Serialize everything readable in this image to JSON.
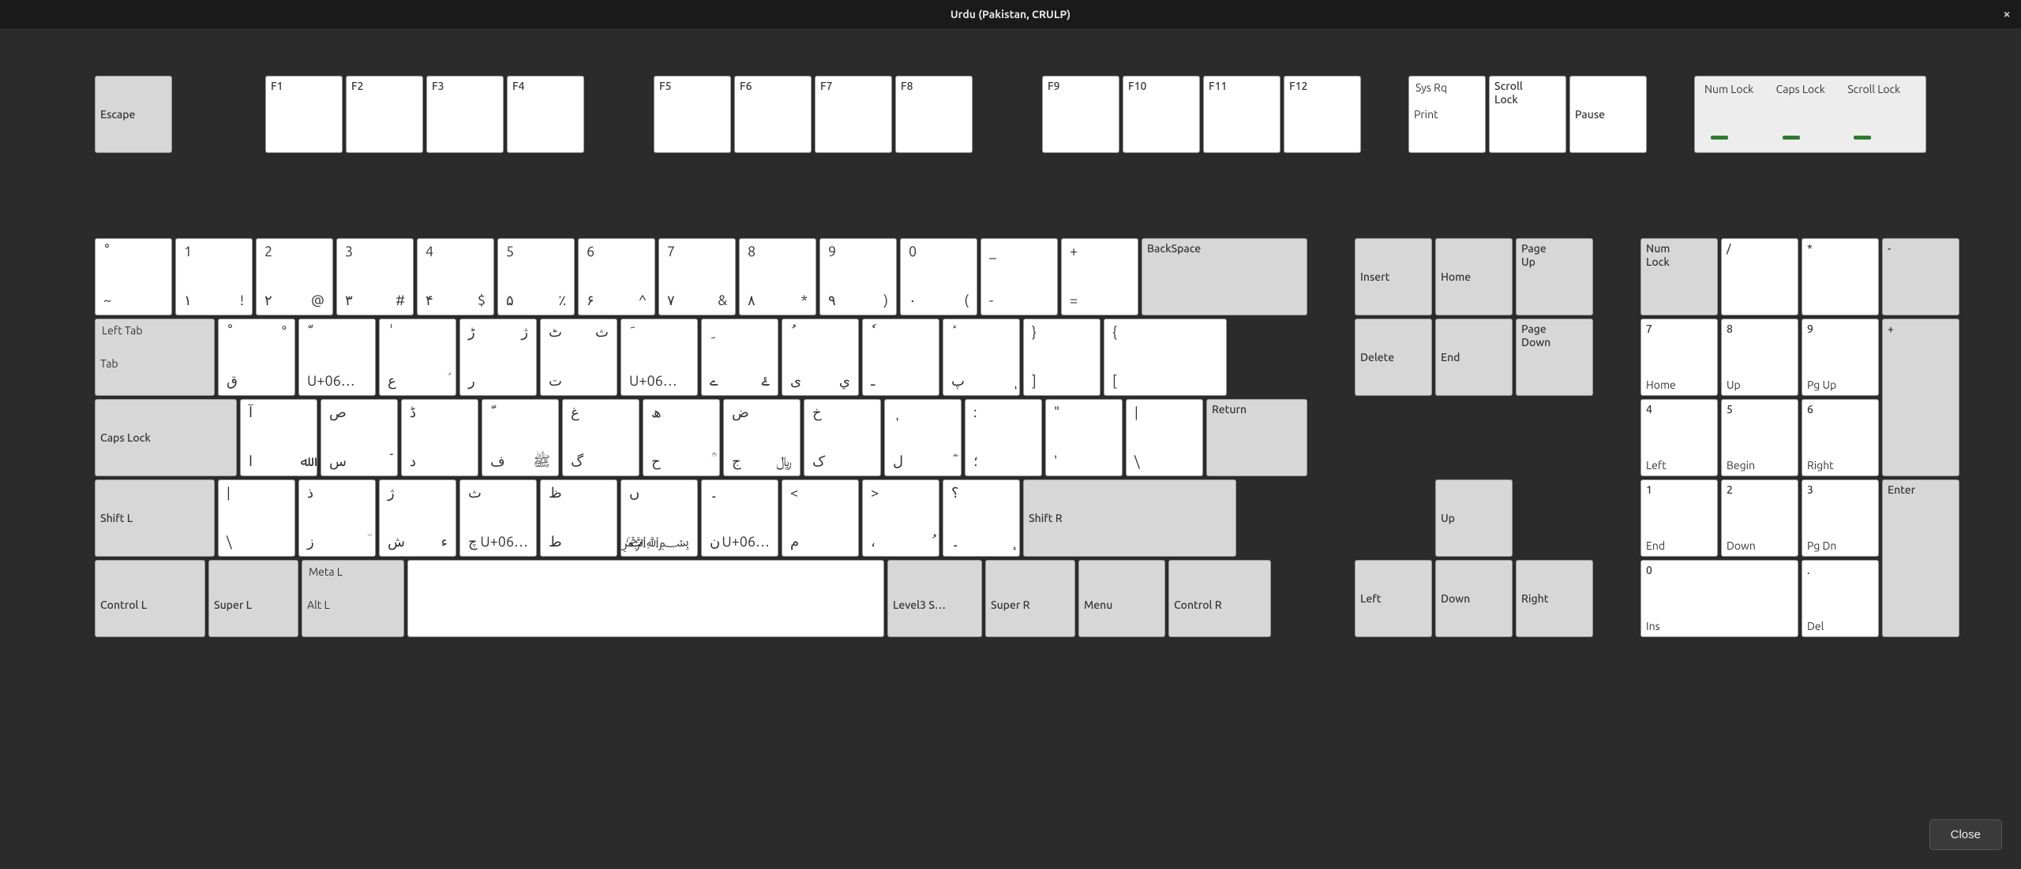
{
  "window": {
    "title": "Urdu (Pakistan, CRULP)"
  },
  "footer": {
    "close": "Close"
  },
  "fnrow": {
    "escape": "Escape",
    "f": [
      "F1",
      "F2",
      "F3",
      "F4",
      "F5",
      "F6",
      "F7",
      "F8",
      "F9",
      "F10",
      "F11",
      "F12"
    ],
    "sysrq_top": "Sys Rq",
    "sysrq_bot": "Print",
    "scrolllock": "Scroll Lock",
    "pause": "Pause",
    "locks": {
      "num": "Num Lock",
      "caps": "Caps Lock",
      "scroll": "Scroll Lock"
    }
  },
  "row1": [
    {
      "tl": "ْ",
      "bl": "~"
    },
    {
      "tl": "1",
      "bl": "١",
      "br": "!"
    },
    {
      "tl": "2",
      "bl": "٢",
      "br": "@"
    },
    {
      "tl": "3",
      "bl": "٣",
      "br": "#"
    },
    {
      "tl": "4",
      "bl": "۴",
      "br": "$"
    },
    {
      "tl": "5",
      "bl": "۵",
      "br": "٪"
    },
    {
      "tl": "6",
      "bl": "۶",
      "br": "^"
    },
    {
      "tl": "7",
      "bl": "۷",
      "br": "&"
    },
    {
      "tl": "8",
      "bl": "۸",
      "br": "*"
    },
    {
      "tl": "9",
      "bl": "۹",
      "br": ")"
    },
    {
      "tl": "0",
      "bl": "٠",
      "br": "("
    },
    {
      "tl": "_",
      "bl": "-"
    },
    {
      "tl": "+",
      "bl": "="
    }
  ],
  "backspace": "BackSpace",
  "tab": {
    "top": "Left Tab",
    "bot": "Tab"
  },
  "row2": [
    {
      "tl": "ْ",
      "bl": "ق",
      "tr": "°"
    },
    {
      "tl": "ّ",
      "bl": "U+06…",
      "tr": ""
    },
    {
      "tl": "ٰ",
      "bl": "ع",
      "tr": "",
      "br": "ؑ"
    },
    {
      "tl": "ڑ",
      "bl": "ر",
      "tr": "ژ",
      "br": ""
    },
    {
      "tl": "ٹ",
      "bl": "ت",
      "tr": "ث",
      "br": ""
    },
    {
      "tl": "َ",
      "bl": "U+06…",
      "tr": "",
      "br": ""
    },
    {
      "tl": "ِ",
      "bl": "ے",
      "tr": "",
      "br": "ۓ"
    },
    {
      "tl": "ُ",
      "bl": "ی",
      "tr": "",
      "br": "ي"
    },
    {
      "tl": "ٗ",
      "bl": "ـ",
      "tr": "",
      "br": ""
    },
    {
      "tl": "ٔ",
      "bl": "پ",
      "tr": "",
      "br": "ٖ"
    },
    {
      "tl": "}",
      "bl": "]",
      "tr": "",
      "br": ""
    },
    {
      "tl": "{",
      "bl": "[",
      "tr": "",
      "br": ""
    }
  ],
  "caps": "Caps Lock",
  "row3": [
    {
      "tl": "آ",
      "bl": "ا",
      "br": "ﷲ"
    },
    {
      "tl": "ص",
      "bl": "س",
      "br": "ؐ"
    },
    {
      "tl": "ڈ",
      "bl": "د",
      "br": ""
    },
    {
      "tl": "ّ",
      "bl": "ف",
      "br": "ﷺ"
    },
    {
      "tl": "غ",
      "bl": "گ",
      "br": ""
    },
    {
      "tl": "ھ",
      "bl": "ح",
      "br": "ؒ"
    },
    {
      "tl": "ض",
      "bl": "ج",
      "br": "﷼"
    },
    {
      "tl": "خ",
      "bl": "ک",
      "br": ""
    },
    {
      "tl": "ٖ",
      "bl": "ل",
      "br": "ؓ"
    },
    {
      "tl": ":",
      "bl": "؛",
      "br": ""
    },
    {
      "tl": "\"",
      "bl": "'",
      "br": ""
    },
    {
      "tl": "|",
      "bl": "\\",
      "br": ""
    }
  ],
  "return": "Return",
  "shiftl": "Shift L",
  "row4": [
    {
      "tl": "|",
      "bl": "\\"
    },
    {
      "tl": "ذ",
      "bl": "ز",
      "br": "ؔ"
    },
    {
      "tl": "ژ",
      "bl": "ش",
      "br": "ء"
    },
    {
      "tl": "ث",
      "bl": "چ",
      "br": "U+06…"
    },
    {
      "tl": "ظ",
      "bl": "ط",
      "br": ""
    },
    {
      "tl": "ں",
      "bl": "ب",
      "br": "﷽"
    },
    {
      "tl": "۔",
      "bl": "ن",
      "br": "U+06…"
    },
    {
      "tl": "<",
      "bl": "م",
      "br": ""
    },
    {
      "tl": ">",
      "bl": "،",
      "br": "ُ"
    },
    {
      "tl": "؟",
      "bl": "۔",
      "br": "ٕ"
    }
  ],
  "shiftr": "Shift R",
  "row5": {
    "ctrl_l": "Control L",
    "super_l": "Super L",
    "meta_l": "Meta L",
    "alt_l": "Alt L",
    "lvl3": "Level3 S…",
    "super_r": "Super R",
    "menu": "Menu",
    "ctrl_r": "Control R"
  },
  "nav": {
    "insert": "Insert",
    "home": "Home",
    "pgup": "Page Up",
    "delete": "Delete",
    "end": "End",
    "pgdn": "Page Down",
    "up": "Up",
    "left": "Left",
    "down": "Down",
    "right": "Right"
  },
  "np": {
    "numlock": "Num Lock",
    "div": "/",
    "mul": "*",
    "sub": "-",
    "7t": "7",
    "7b": "Home",
    "8t": "8",
    "8b": "Up",
    "9t": "9",
    "9b": "Pg Up",
    "add": "+",
    "4t": "4",
    "4b": "Left",
    "5t": "5",
    "5b": "Begin",
    "6t": "6",
    "6b": "Right",
    "1t": "1",
    "1b": "End",
    "2t": "2",
    "2b": "Down",
    "3t": "3",
    "3b": "Pg Dn",
    "enter": "Enter",
    "0t": "0",
    "0b": "Ins",
    "dott": ".",
    "dotb": "Del"
  }
}
